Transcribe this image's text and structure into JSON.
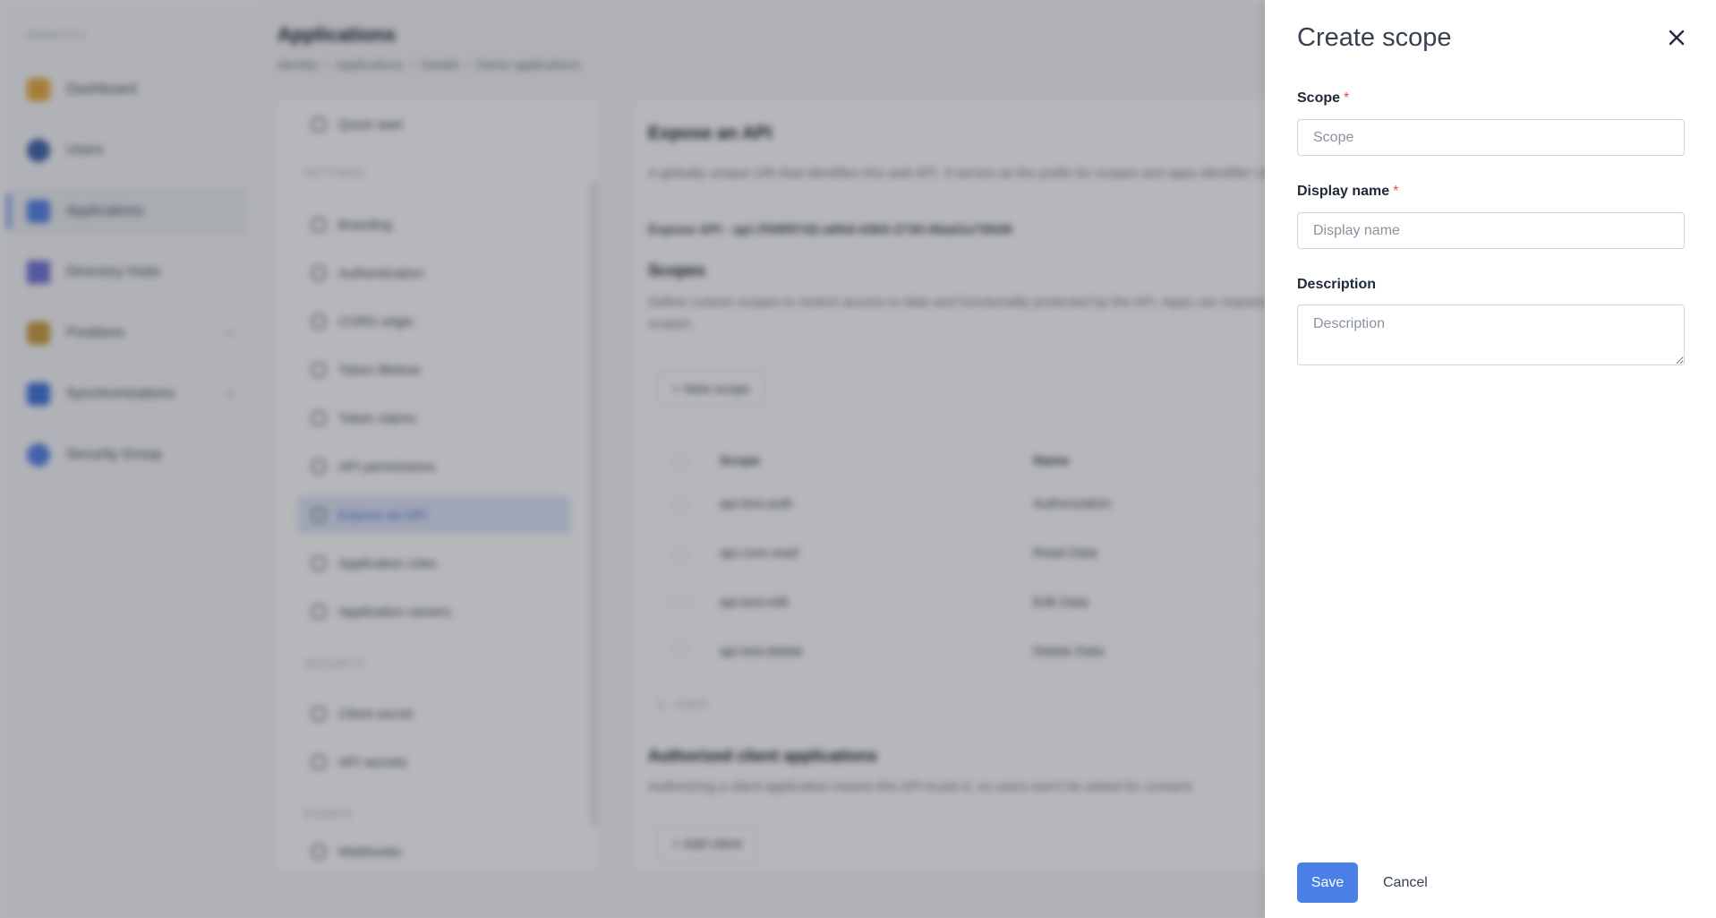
{
  "background": {
    "sidebar": {
      "section_label": "IDENTITY",
      "items": [
        {
          "label": "Dashboard",
          "icon": "dashboard-icon",
          "color": "#e8a838"
        },
        {
          "label": "Users",
          "icon": "users-icon",
          "color": "#3b5fa8"
        },
        {
          "label": "Applications",
          "icon": "applications-icon",
          "color": "#4f7fe8",
          "active": true
        },
        {
          "label": "Directory Hubs",
          "icon": "directory-icon",
          "color": "#6b6fd6"
        },
        {
          "label": "Positions",
          "icon": "positions-icon",
          "color": "#c79a3a"
        },
        {
          "label": "Synchronizations",
          "icon": "sync-icon",
          "color": "#3b72d8"
        },
        {
          "label": "Security Group",
          "icon": "shield-icon",
          "color": "#4f7fe8"
        }
      ]
    },
    "header": {
      "title": "Applications",
      "breadcrumb": [
        "Identity",
        "Applications",
        "Details",
        "Demo applications"
      ]
    },
    "settings_menu": {
      "items": [
        "Quick start",
        "Branding",
        "Authentication",
        "CORS origin",
        "Token lifetime",
        "Token claims",
        "API permissions",
        "Expose an API",
        "Application roles",
        "Application owners",
        "Client secret",
        "API secrets",
        "Webhooks"
      ],
      "groups": [
        "SETTINGS",
        "SECURITY",
        "EVENTS"
      ]
    },
    "content": {
      "title": "Expose an API",
      "description": "A globally unique URI that identifies this web API. It serves as the prefix for scopes and apps identifier URI.",
      "identifier": "Expose API : api://f49f97d2-a85d-43b0-2730-06ad1e70b08",
      "scopes_title": "Scopes",
      "scopes_description": "Define custom scopes to restrict access to data and functionality protected by the API. Apps can request these scopes.",
      "new_scope_label": "+ New scope",
      "table_headers": [
        "Scope",
        "Name"
      ],
      "rows": [
        [
          "api.test.auth",
          "Authorization"
        ],
        [
          "api.core.read",
          "Read Data"
        ],
        [
          "api.test.edit",
          "Edit Data"
        ],
        [
          "api.test.delete",
          "Delete Data"
        ]
      ],
      "pagination": "1 - 4 of 4",
      "clients_title": "Authorized client applications",
      "clients_description": "Authorizing a client application means this API trusts it, so users won't be asked for consent.",
      "add_client_label": "+ Add client"
    }
  },
  "drawer": {
    "title": "Create scope",
    "close_icon": "close-icon",
    "fields": {
      "scope": {
        "label": "Scope",
        "required_mark": "*",
        "placeholder": "Scope",
        "value": ""
      },
      "display_name": {
        "label": "Display name",
        "required_mark": "*",
        "placeholder": "Display name",
        "value": ""
      },
      "description": {
        "label": "Description",
        "placeholder": "Description",
        "value": ""
      }
    },
    "save_label": "Save",
    "cancel_label": "Cancel"
  },
  "colors": {
    "accent": "#4a7fe5",
    "required": "#ef4444"
  }
}
